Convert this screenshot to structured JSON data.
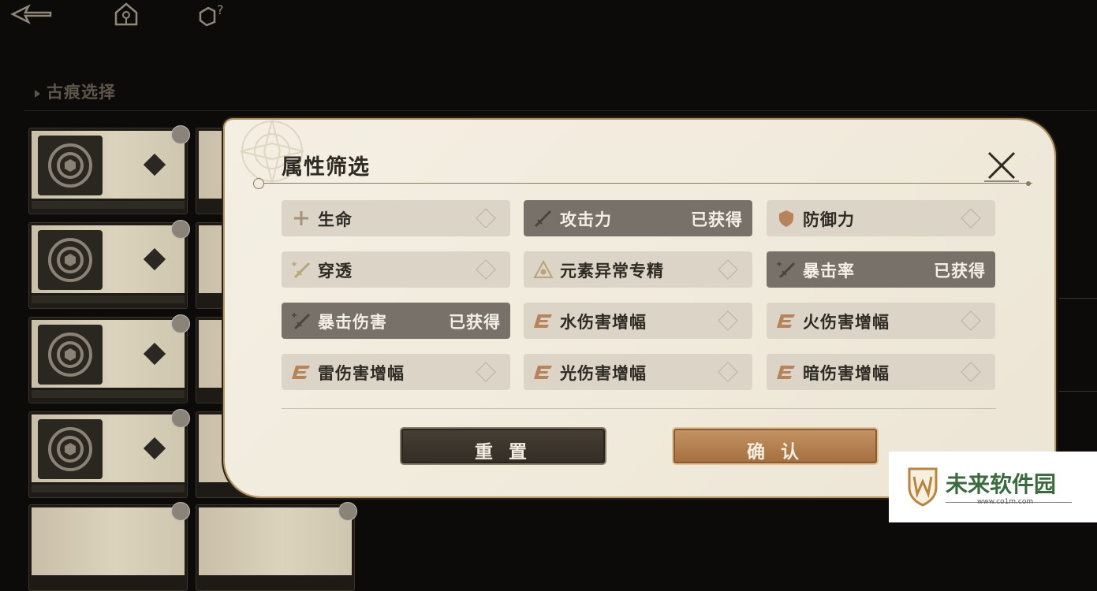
{
  "header": {
    "back_icon": "back-arrow-icon",
    "home_icon": "home-icon",
    "help_icon": "help-icon"
  },
  "background": {
    "section_title": "古痕选择"
  },
  "modal": {
    "title": "属性筛选",
    "close_icon": "close-icon",
    "attributes": [
      {
        "label": "生命",
        "icon": "plus-icon",
        "status": ""
      },
      {
        "label": "攻击力",
        "icon": "sword-icon",
        "status": "已获得"
      },
      {
        "label": "防御力",
        "icon": "shield-icon",
        "status": ""
      },
      {
        "label": "穿透",
        "icon": "sword-plus-icon",
        "status": ""
      },
      {
        "label": "元素异常专精",
        "icon": "triangle-icon",
        "status": ""
      },
      {
        "label": "暴击率",
        "icon": "sword-plus-icon",
        "status": "已获得"
      },
      {
        "label": "暴击伤害",
        "icon": "sword-plus-icon",
        "status": "已获得"
      },
      {
        "label": "水伤害增幅",
        "icon": "element-e-icon",
        "status": ""
      },
      {
        "label": "火伤害增幅",
        "icon": "element-e-icon",
        "status": ""
      },
      {
        "label": "雷伤害增幅",
        "icon": "element-e-icon",
        "status": ""
      },
      {
        "label": "光伤害增幅",
        "icon": "element-e-icon",
        "status": ""
      },
      {
        "label": "暗伤害增幅",
        "icon": "element-e-icon",
        "status": ""
      }
    ],
    "reset_label": "重 置",
    "confirm_label": "确 认"
  },
  "watermark": {
    "name": "未来软件园",
    "url": "www.co1m.com"
  },
  "colors": {
    "selected_bg": "#77716a",
    "unselected_bg": "#dcd5c7",
    "confirm": "#b07a4a",
    "reset": "#3b342c"
  }
}
